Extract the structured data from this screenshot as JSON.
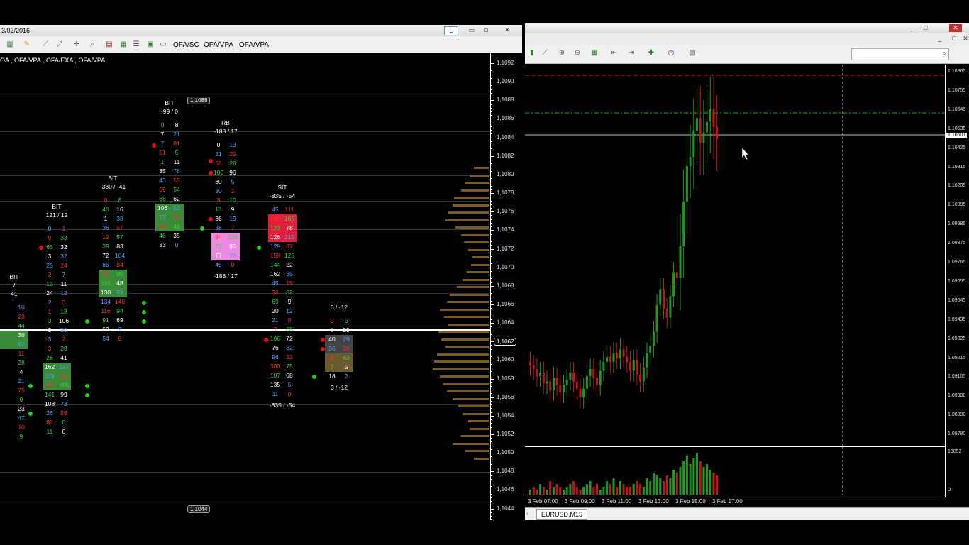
{
  "left_window": {
    "title": "3/02/2016",
    "controls": {
      "layout_btn": "L",
      "minimize": "▭",
      "restore": "⧉",
      "close": "✕"
    },
    "toolbar": {
      "icons": [
        "chart-bars-icon",
        "pencil-icon",
        "line-tool-icon",
        "pointer-icon",
        "crosshair-icon",
        "zoom-icon",
        "bars-settings-icon",
        "table-icon",
        "list-icon",
        "box-icon",
        "window-icon"
      ],
      "buttons": [
        "OFA/SC",
        "OFA/VPA",
        "OFA/VPA"
      ]
    },
    "indicator_label": "OA , OFA/VPA , OFA/EXA , OFA/VPA",
    "price_scale": [
      "1,1092",
      "1,1090",
      "1,1088",
      "1,1086",
      "1,1084",
      "1,1082",
      "1,1080",
      "1,1078",
      "1,1076",
      "1,1074",
      "1,1072",
      "1,1070",
      "1,1068",
      "1,1066",
      "1,1064",
      "1,1062",
      "1,1060",
      "1,1058",
      "1,1056",
      "1,1054",
      "1,1052",
      "1,1050",
      "1,1048",
      "1,1046",
      "1,1044"
    ],
    "current_price": "1,1062",
    "high_marker": "1,1088",
    "low_marker": "1,1044",
    "footprints": [
      {
        "head": [
          "BIT",
          "/",
          "41"
        ],
        "cells": [
          [
            "",
            "10"
          ],
          [
            "",
            "23"
          ],
          [
            "",
            "44"
          ],
          [
            "",
            "36"
          ],
          [
            "",
            "82"
          ],
          [
            "",
            "11"
          ],
          [
            "",
            "28"
          ],
          [
            "",
            "4"
          ],
          [
            "",
            "21"
          ],
          [
            "",
            "75"
          ],
          [
            "",
            "0"
          ],
          [
            "",
            "23"
          ],
          [
            "",
            "47"
          ],
          [
            "",
            "10"
          ],
          [
            "",
            "9"
          ]
        ]
      },
      {
        "head": [
          "BIT",
          "121  /  12"
        ],
        "cells": [
          [
            "0",
            "1"
          ],
          [
            "0",
            "33"
          ],
          [
            "66",
            "32"
          ],
          [
            "3",
            "32"
          ],
          [
            "25",
            "24"
          ],
          [
            "2",
            "7"
          ],
          [
            "13",
            "11"
          ],
          [
            "24",
            "12"
          ],
          [
            "2",
            "3"
          ],
          [
            "1",
            "18"
          ],
          [
            "3",
            "106"
          ],
          [
            "3",
            "90"
          ],
          [
            "3",
            "2"
          ],
          [
            "3",
            "28"
          ],
          [
            "26",
            "41"
          ],
          [
            "162",
            "177"
          ],
          [
            "119",
            "153"
          ],
          [
            "181",
            "155"
          ],
          [
            "141",
            "99"
          ],
          [
            "108",
            "73"
          ],
          [
            "26",
            "56"
          ],
          [
            "88",
            "8"
          ],
          [
            "11",
            "0"
          ]
        ]
      },
      {
        "head": [
          "BIT",
          "-330  /  -41"
        ],
        "cells": [
          [
            "0",
            "8"
          ],
          [
            "40",
            "16"
          ],
          [
            "1",
            "38"
          ],
          [
            "36",
            "57"
          ],
          [
            "12",
            "57"
          ],
          [
            "39",
            "83"
          ],
          [
            "72",
            "104"
          ],
          [
            "85",
            "84"
          ],
          [
            "111",
            "90"
          ],
          [
            "145",
            "48"
          ],
          [
            "130",
            "53"
          ],
          [
            "134",
            "149"
          ],
          [
            "116",
            "94"
          ],
          [
            "91",
            "69"
          ],
          [
            "62",
            "2"
          ],
          [
            "54",
            "0"
          ]
        ]
      },
      {
        "head": [
          "BIT",
          "-99  /  0"
        ],
        "cells": [
          [
            "0",
            "8"
          ],
          [
            "7",
            "21"
          ],
          [
            "7",
            "81"
          ],
          [
            "51",
            "5"
          ],
          [
            "1",
            "11"
          ],
          [
            "35",
            "78"
          ],
          [
            "43",
            "55"
          ],
          [
            "69",
            "54"
          ],
          [
            "68",
            "62"
          ],
          [
            "106",
            "52"
          ],
          [
            "77",
            "58"
          ],
          [
            "92",
            "46"
          ],
          [
            "46",
            "35"
          ],
          [
            "33",
            "0"
          ]
        ]
      },
      {
        "head": [
          "RB",
          "-188  /  17"
        ],
        "cells": [
          [
            "0",
            "13"
          ],
          [
            "21",
            "29"
          ],
          [
            "56",
            "28"
          ],
          [
            "100",
            "96"
          ],
          [
            "80",
            "5"
          ],
          [
            "30",
            "2"
          ],
          [
            "3",
            "10"
          ],
          [
            "13",
            "9"
          ],
          [
            "36",
            "19"
          ],
          [
            "38",
            "7"
          ],
          [
            "84",
            "128"
          ],
          [
            "73",
            "85"
          ],
          [
            "77",
            "78"
          ],
          [
            "45",
            "0"
          ]
        ]
      },
      {
        "head": [
          "SIT",
          "-835  /  -54"
        ],
        "cells": [
          [
            "45",
            "111"
          ],
          [
            "160",
            "165"
          ],
          [
            "123",
            "78"
          ],
          [
            "126",
            "215"
          ],
          [
            "129",
            "87"
          ],
          [
            "159",
            "125"
          ],
          [
            "144",
            "22"
          ],
          [
            "162",
            "35"
          ],
          [
            "45",
            "15"
          ],
          [
            "36",
            "62"
          ],
          [
            "69",
            "9"
          ],
          [
            "20",
            "12"
          ],
          [
            "21",
            "8"
          ],
          [
            "7",
            "68"
          ],
          [
            "106",
            "72"
          ],
          [
            "76",
            "32"
          ],
          [
            "96",
            "33"
          ],
          [
            "300",
            "75"
          ],
          [
            "107",
            "68"
          ],
          [
            "135",
            "5"
          ],
          [
            "11",
            "0"
          ]
        ]
      },
      {
        "head": [
          "",
          "3  /  -12"
        ],
        "cells": [
          [
            "0",
            "6"
          ],
          [
            "0",
            "29"
          ],
          [
            "40",
            "29"
          ],
          [
            "56",
            "26"
          ],
          [
            "6",
            "63"
          ],
          [
            "7",
            "5"
          ],
          [
            "18",
            "2"
          ]
        ]
      }
    ]
  },
  "right_window": {
    "controls": {
      "minimize": "_",
      "restore": "□",
      "close": "✕"
    },
    "toolbar_icons": [
      "candles-icon",
      "line-chart-icon",
      "zoom-in-icon",
      "zoom-out-icon",
      "grid-icon",
      "scroll-icon",
      "autoscroll-icon",
      "indicators-icon",
      "clock-icon",
      "templates-icon"
    ],
    "search_icon": "search-icon",
    "price_axis": [
      "1.10865",
      "1.10755",
      "1.10645",
      "1.10535",
      "1.10425",
      "1.10315",
      "1.10205",
      "1.10095",
      "1.09985",
      "1.09875",
      "1.09765",
      "1.09655",
      "1.09545",
      "1.09435",
      "1.09325",
      "1.09215",
      "1.09105",
      "1.09000",
      "1.08890",
      "1.08780"
    ],
    "current_price": "1.10507",
    "volume_axis": [
      "13852",
      "0"
    ],
    "time_axis": [
      "3 Feb 07:00",
      "3 Feb 09:00",
      "3 Feb 11:00",
      "3 Feb 13:00",
      "3 Feb 15:00",
      "3 Feb 17:00"
    ],
    "symbol_tab": "EURUSD,M15",
    "chart_data": {
      "type": "candlestick",
      "symbol": "EURUSD",
      "timeframe": "M15",
      "ylim": [
        1.0878,
        1.1092
      ],
      "candles_close": [
        1.0923,
        1.0921,
        1.0917,
        1.0919,
        1.0913,
        1.0914,
        1.0909,
        1.0916,
        1.0912,
        1.0908,
        1.0912,
        1.0915,
        1.0919,
        1.0914,
        1.091,
        1.0905,
        1.091,
        1.0917,
        1.0921,
        1.0916,
        1.0912,
        1.092,
        1.0925,
        1.0928,
        1.0925,
        1.093,
        1.0927,
        1.0932,
        1.0928,
        1.0925,
        1.092,
        1.0926,
        1.0918,
        1.0914,
        1.0922,
        1.093,
        1.0934,
        1.0942,
        1.0957,
        1.0966,
        1.0955,
        1.095,
        1.0962,
        1.0975,
        1.0972,
        1.099,
        1.1015,
        1.1035,
        1.104,
        1.1055,
        1.1062,
        1.1048,
        1.1054,
        1.106,
        1.1067,
        1.1057,
        1.105
      ],
      "volumes": [
        2,
        3,
        2,
        4,
        3,
        2,
        5,
        3,
        4,
        3,
        2,
        3,
        4,
        5,
        3,
        2,
        3,
        4,
        5,
        3,
        4,
        2,
        3,
        5,
        4,
        6,
        3,
        5,
        4,
        3,
        3,
        4,
        5,
        4,
        3,
        6,
        5,
        8,
        7,
        6,
        5,
        7,
        6,
        9,
        8,
        10,
        12,
        14,
        11,
        13,
        15,
        12,
        10,
        11,
        9,
        8,
        7
      ]
    }
  }
}
